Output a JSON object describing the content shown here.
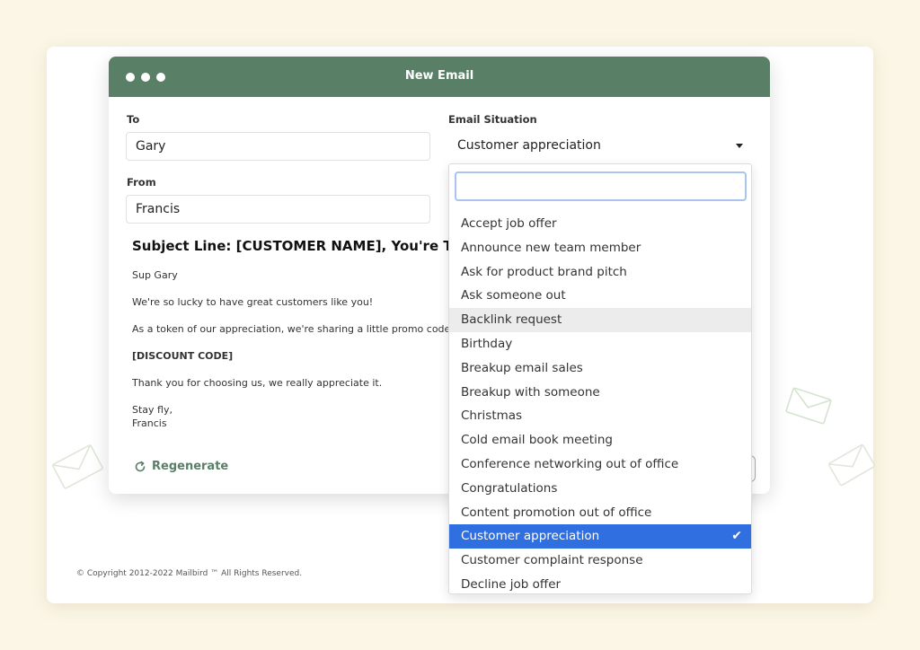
{
  "window": {
    "title": "New Email"
  },
  "form": {
    "to_label": "To",
    "to_value": "Gary",
    "from_label": "From",
    "from_value": "Francis",
    "situation_label": "Email Situation",
    "situation_value": "Customer appreciation"
  },
  "email": {
    "subject": "Subject Line: [CUSTOMER NAME], You're The Be",
    "greeting": "Sup Gary",
    "line1": "We're so lucky to have great customers like you!",
    "line2": "As a token of our appreciation, we're sharing a little promo code for yo",
    "code": "[DISCOUNT CODE]",
    "line3": "Thank you for choosing us, we really appreciate it.",
    "signoff": "Stay fly,",
    "signature": "Francis"
  },
  "actions": {
    "regenerate_label": "Regenerate"
  },
  "dropdown": {
    "search_value": "",
    "items": [
      "Accept job offer",
      "Announce new team member",
      "Ask for product brand pitch",
      "Ask someone out",
      "Backlink request",
      "Birthday",
      "Breakup email sales",
      "Breakup with someone",
      "Christmas",
      "Cold email book meeting",
      "Conference networking out of office",
      "Congratulations",
      "Content promotion out of office",
      "Customer appreciation",
      "Customer complaint response",
      "Decline job offer"
    ],
    "hovered_index": 4,
    "selected_index": 13
  },
  "footer": {
    "copyright": "© Copyright 2012-2022 Mailbird ™ All Rights Reserved."
  },
  "colors": {
    "accent_green": "#5a7f67",
    "selected_blue": "#2f6fe0",
    "page_background": "#fbf6e6"
  }
}
